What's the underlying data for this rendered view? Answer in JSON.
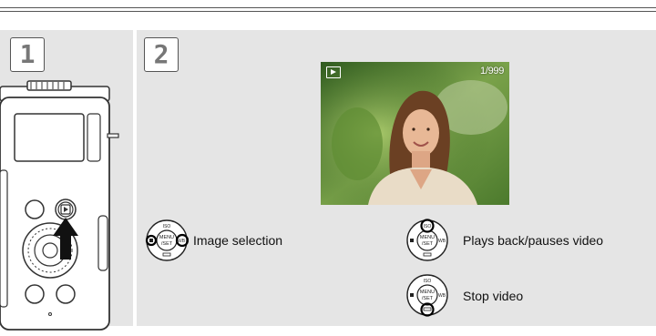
{
  "steps": [
    "1",
    "2"
  ],
  "photo": {
    "counter": "1/999",
    "mode_icon": "playback-icon"
  },
  "controls": [
    {
      "label": "Image selection",
      "icon": "control-dial-arrows-icon"
    },
    {
      "label": "Plays back/pauses video",
      "icon": "control-dial-up-icon"
    },
    {
      "label": "Stop video",
      "icon": "control-dial-down-icon"
    }
  ],
  "dial_text": {
    "top": "ISO",
    "center_top": "MENU",
    "center_bottom": "/SET",
    "right": "WB"
  },
  "colors": {
    "panel": "#e5e5e5",
    "highlight_ring": "#000000"
  }
}
